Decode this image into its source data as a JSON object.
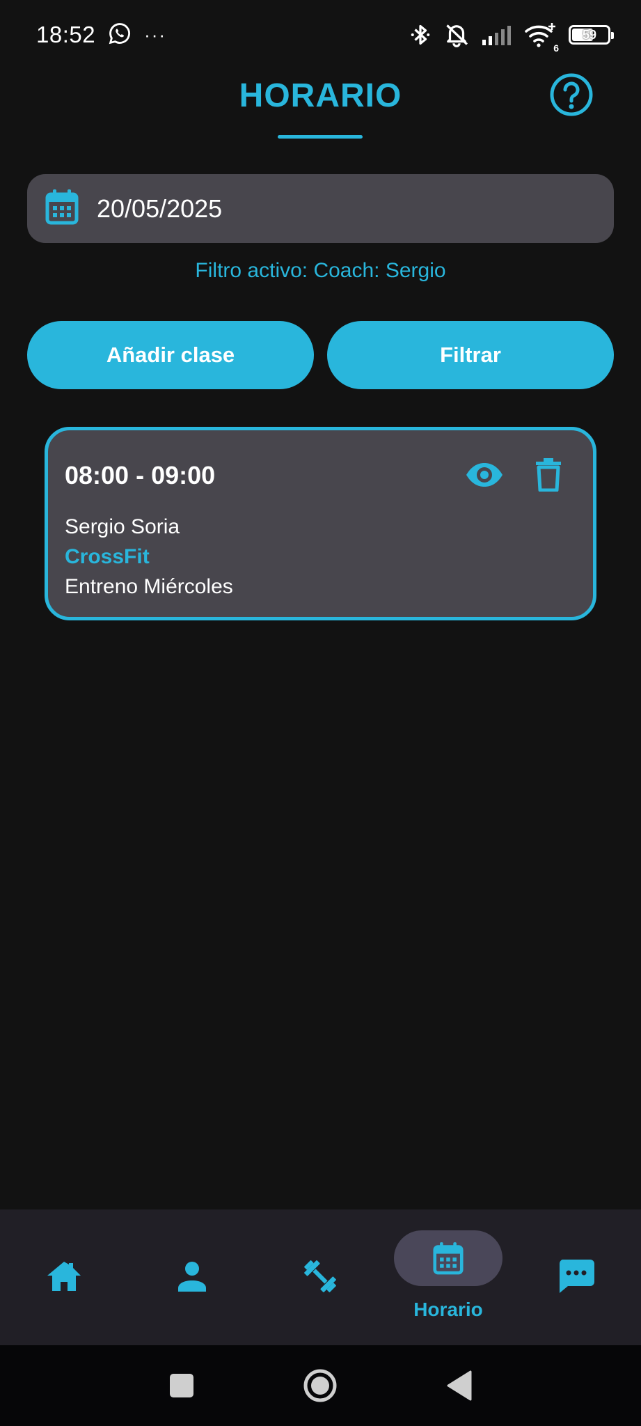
{
  "status_bar": {
    "time": "18:52",
    "more": "···",
    "battery": "59",
    "battery_level": 0.59,
    "network_sub": "6"
  },
  "header": {
    "title": "HORARIO",
    "help_icon": "help-circle-icon"
  },
  "date_field": {
    "icon": "calendar-icon",
    "value": "20/05/2025"
  },
  "filter_status": "Filtro activo: Coach: Sergio",
  "actions": {
    "add_label": "Añadir clase",
    "filter_label": "Filtrar"
  },
  "classes": [
    {
      "time": "08:00 - 09:00",
      "coach": "Sergio Soria",
      "type": "CrossFit",
      "name": "Entreno Miércoles"
    }
  ],
  "bottom_nav": {
    "items": [
      {
        "icon": "home-icon",
        "label": ""
      },
      {
        "icon": "person-icon",
        "label": ""
      },
      {
        "icon": "dumbbell-icon",
        "label": ""
      },
      {
        "icon": "calendar-icon",
        "label": "Horario",
        "active": true
      },
      {
        "icon": "chat-icon",
        "label": ""
      }
    ]
  },
  "colors": {
    "accent": "#29b6dc",
    "background": "#121212",
    "surface": "#48464d",
    "nav_background": "#211f26"
  }
}
